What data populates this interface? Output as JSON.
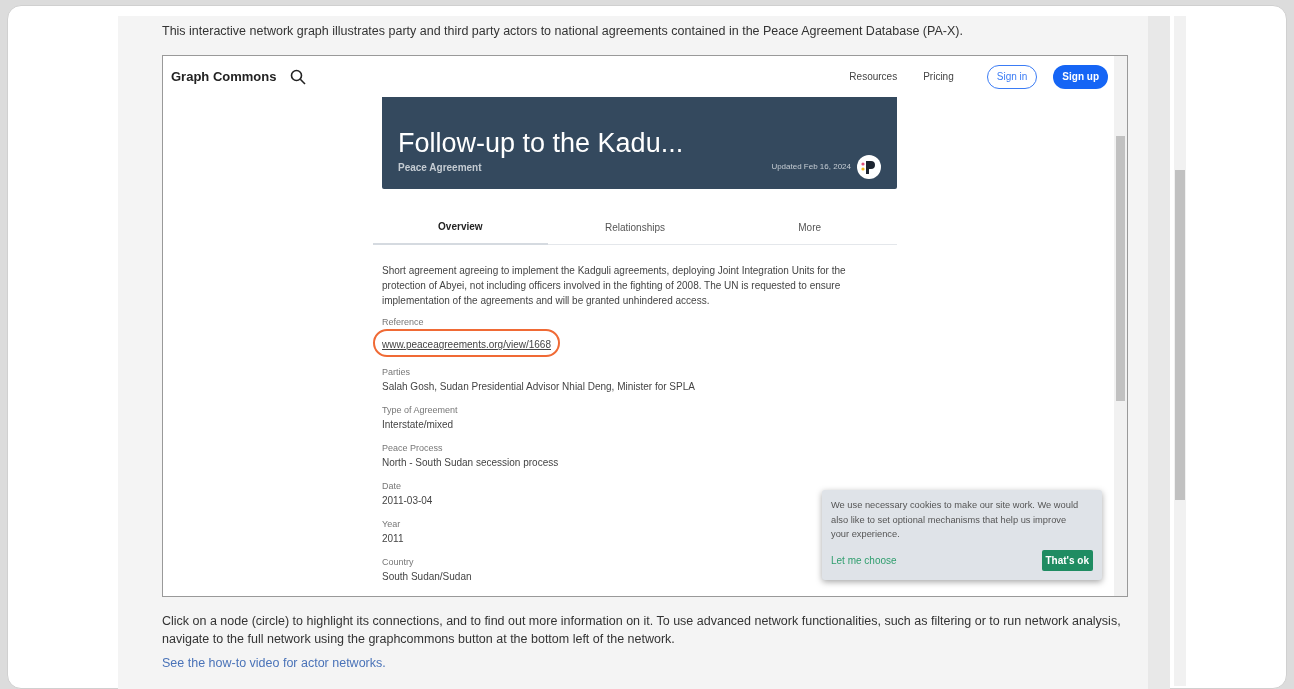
{
  "intro": "This interactive network graph illustrates party and third party actors to national agreements contained in the Peace Agreement Database (PA-X).",
  "embed": {
    "brand": "Graph Commons",
    "nav": [
      "Resources",
      "Pricing"
    ],
    "buttons": [
      {
        "label": "Sign in",
        "kind": "outline"
      },
      {
        "label": "Sign up",
        "kind": "filled"
      }
    ],
    "banner": {
      "title": "Follow-up to the Kadu...",
      "subtitle": "Peace Agreement",
      "updated": "Updated Feb 16, 2024"
    },
    "tabs": [
      {
        "label": "Overview",
        "selected": true
      },
      {
        "label": "Relationships",
        "selected": false
      },
      {
        "label": "More",
        "selected": false
      }
    ],
    "description": "Short agreement agreeing to implement the Kadguli agreements, deploying Joint Integration Units for the protection of Abyei, not including officers involved in the fighting of 2008. The UN is requested to ensure implementation of the agreements and will be granted unhindered access.",
    "fields": [
      {
        "label": "Reference",
        "value": "www.peaceagreements.org/view/1668",
        "kind": "link",
        "highlighted": true
      },
      {
        "label": "Parties",
        "value": "Salah Gosh, Sudan Presidential Advisor Nhial Deng, Minister for SPLA",
        "kind": "text",
        "highlighted": false
      },
      {
        "label": "Type of Agreement",
        "value": "Interstate/mixed",
        "kind": "text",
        "highlighted": false
      },
      {
        "label": "Peace Process",
        "value": "North - South Sudan secession process",
        "kind": "text",
        "highlighted": false
      },
      {
        "label": "Date",
        "value": "2011-03-04",
        "kind": "text",
        "highlighted": false
      },
      {
        "label": "Year",
        "value": "2011",
        "kind": "text",
        "highlighted": false
      },
      {
        "label": "Country",
        "value": "South Sudan/Sudan",
        "kind": "text",
        "highlighted": false
      }
    ],
    "cookie": {
      "text": "We use necessary cookies to make our site work. We would also like to set optional mechanisms that help us improve your experience.",
      "choose": "Let me choose",
      "accept": "That's ok"
    }
  },
  "outro": "Click on a node (circle) to highlight its connections, and to find out more information on it. To use advanced network functionalities, such as filtering or to run network analysis, navigate to the full network using the graphcommons button at the bottom left of the network.",
  "video_link": "See the how-to video for actor networks."
}
